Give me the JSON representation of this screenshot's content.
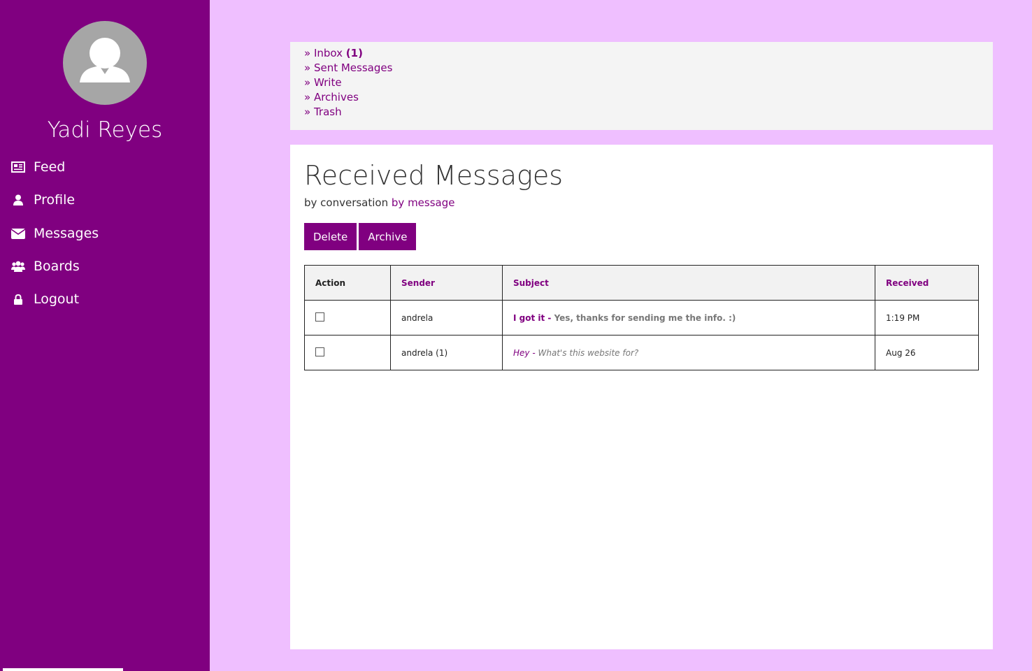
{
  "user": {
    "name": "Yadi Reyes"
  },
  "nav": [
    {
      "label": "Feed",
      "icon": "newspaper-icon"
    },
    {
      "label": "Profile",
      "icon": "user-icon"
    },
    {
      "label": "Messages",
      "icon": "envelope-icon"
    },
    {
      "label": "Boards",
      "icon": "users-icon"
    },
    {
      "label": "Logout",
      "icon": "lock-icon"
    }
  ],
  "folders": {
    "inbox": {
      "label": "» Inbox",
      "count": "(1)"
    },
    "sent": "» Sent Messages",
    "write": "» Write",
    "archives": "» Archives",
    "trash": "» Trash"
  },
  "main": {
    "title": "Received Messages",
    "view_conversation": "by conversation",
    "view_message": "by message",
    "delete_label": "Delete",
    "archive_label": "Archive"
  },
  "table": {
    "headers": {
      "action": "Action",
      "sender": "Sender",
      "subject": "Subject",
      "received": "Received"
    },
    "rows": [
      {
        "sender": "andrela",
        "subject": "I got it - ",
        "preview": "Yes, thanks for sending me the info. :)",
        "received": "1:19 PM",
        "unread": true
      },
      {
        "sender": "andrela (1)",
        "subject": "Hey - ",
        "preview": "What's this website for?",
        "received": "Aug 26",
        "unread": false
      }
    ]
  },
  "colors": {
    "brand": "#800080",
    "background": "#efbfff",
    "panel": "#f4f4f4"
  }
}
